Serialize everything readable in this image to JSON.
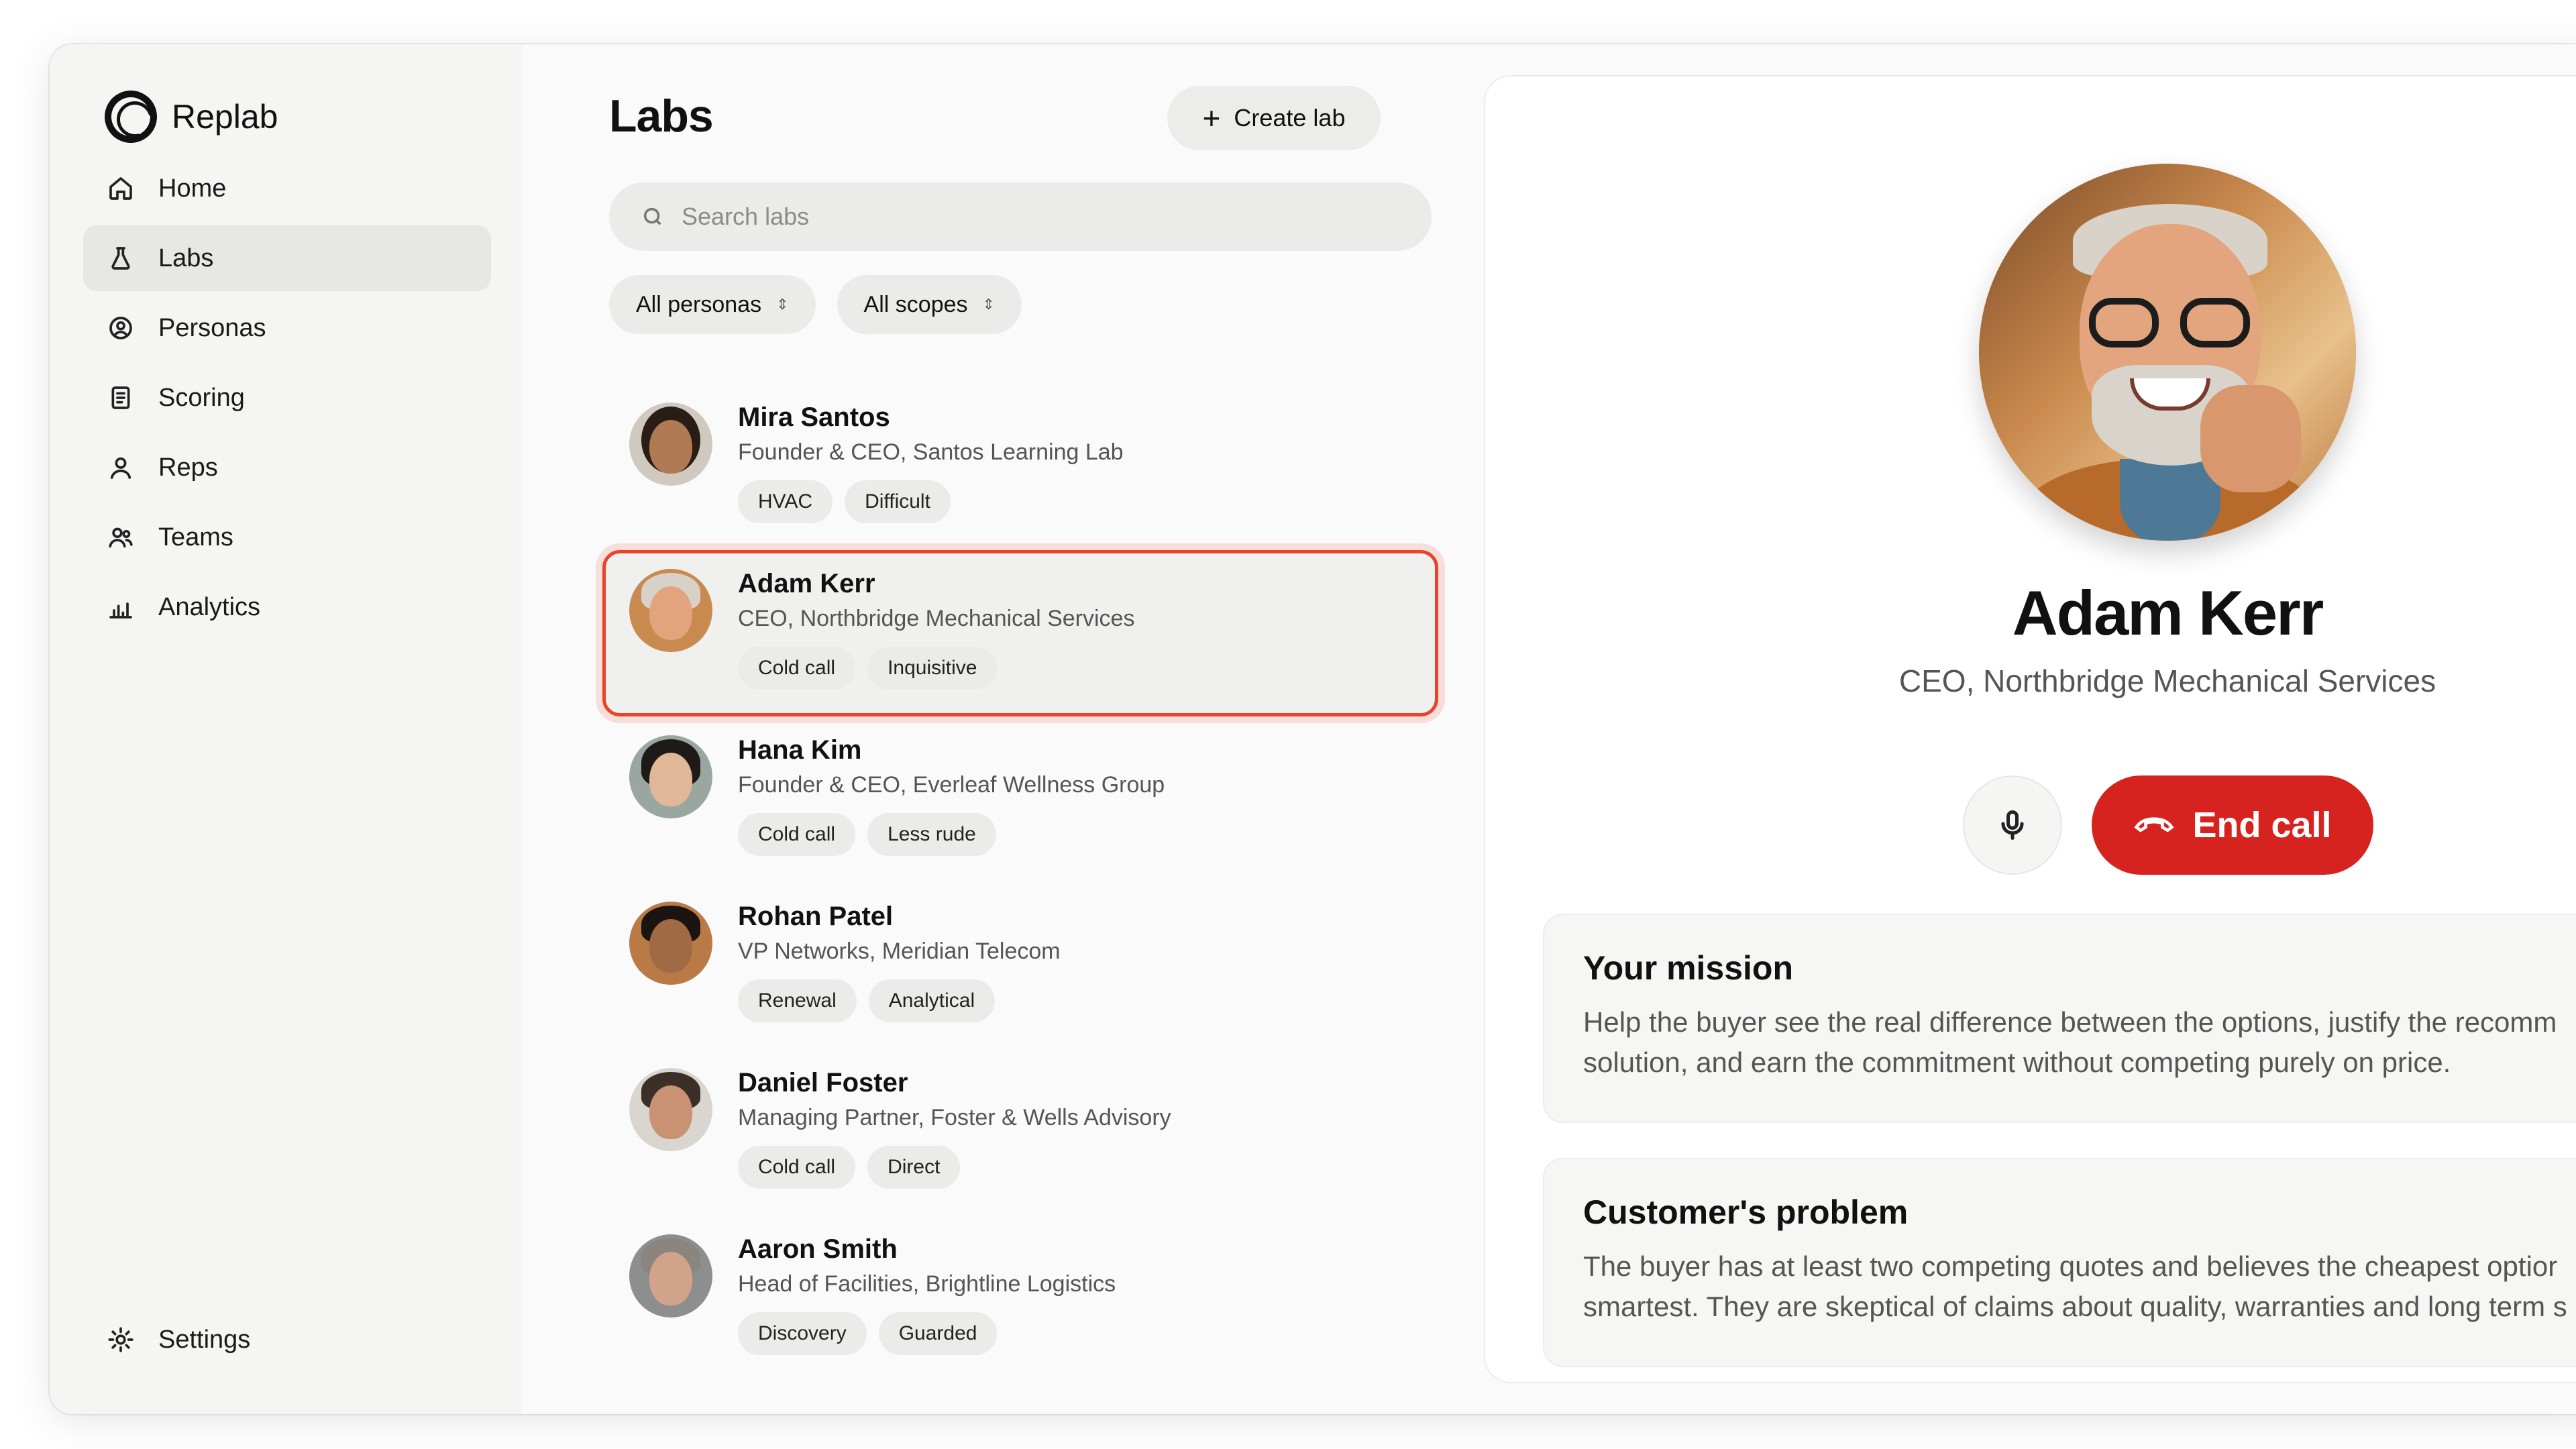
{
  "app": {
    "name": "Replab"
  },
  "sidebar": {
    "items": [
      {
        "label": "Home",
        "icon": "home-icon"
      },
      {
        "label": "Labs",
        "icon": "flask-icon",
        "active": true
      },
      {
        "label": "Personas",
        "icon": "user-circle-icon"
      },
      {
        "label": "Scoring",
        "icon": "clipboard-icon"
      },
      {
        "label": "Reps",
        "icon": "user-icon"
      },
      {
        "label": "Teams",
        "icon": "users-icon"
      },
      {
        "label": "Analytics",
        "icon": "bar-chart-icon"
      }
    ],
    "settings": {
      "label": "Settings",
      "icon": "sun-gear-icon"
    }
  },
  "labs": {
    "title": "Labs",
    "create_label": "Create lab",
    "search_placeholder": "Search labs",
    "filters": [
      {
        "label": "All personas"
      },
      {
        "label": "All scopes"
      }
    ],
    "items": [
      {
        "name": "Mira Santos",
        "role": "Founder & CEO, Santos Learning Lab",
        "tags": [
          "HVAC",
          "Difficult"
        ]
      },
      {
        "name": "Adam Kerr",
        "role": "CEO, Northbridge Mechanical Services",
        "tags": [
          "Cold call",
          "Inquisitive"
        ],
        "selected": true
      },
      {
        "name": "Hana Kim",
        "role": "Founder & CEO, Everleaf Wellness Group",
        "tags": [
          "Cold call",
          "Less rude"
        ]
      },
      {
        "name": "Rohan Patel",
        "role": "VP Networks, Meridian Telecom",
        "tags": [
          "Renewal",
          "Analytical"
        ]
      },
      {
        "name": "Daniel Foster",
        "role": "Managing Partner, Foster & Wells Advisory",
        "tags": [
          "Cold call",
          "Direct"
        ]
      },
      {
        "name": "Aaron Smith",
        "role": "Head of Facilities, Brightline Logistics",
        "tags": [
          "Discovery",
          "Guarded"
        ]
      }
    ]
  },
  "detail": {
    "name": "Adam Kerr",
    "role": "CEO, Northbridge Mechanical Services",
    "end_call_label": "End call",
    "mission": {
      "title": "Your mission",
      "line1": "Help the buyer see the real difference between the options, justify the recomm",
      "line2": "solution, and earn the commitment without competing purely on price."
    },
    "problem": {
      "title": "Customer's problem",
      "line1": "The buyer has at least two competing quotes and believes the cheapest optior",
      "line2": "smartest. They are skeptical of claims about quality, warranties and long term s"
    }
  },
  "colors": {
    "accent_red": "#d7231f",
    "selection_border": "#e8442a"
  }
}
